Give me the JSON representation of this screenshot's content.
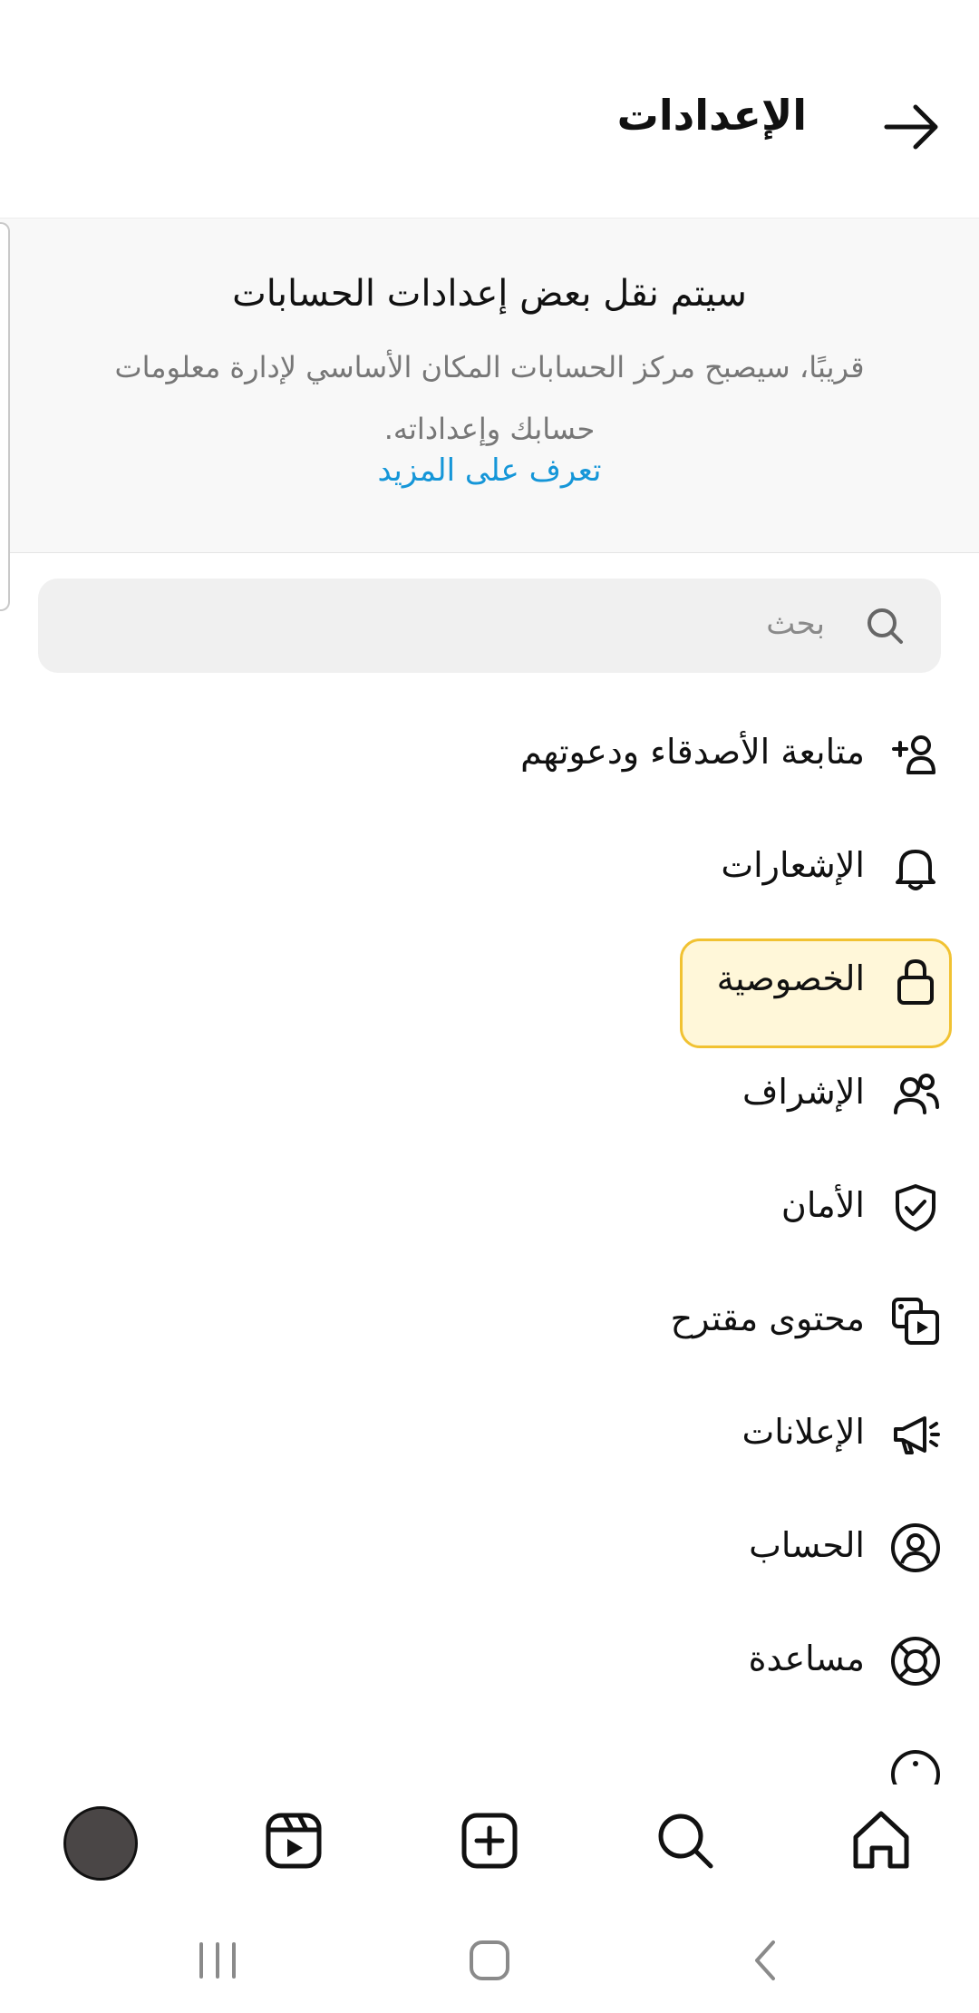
{
  "header": {
    "title": "الإعدادات"
  },
  "banner": {
    "title": "سيتم نقل بعض إعدادات الحسابات",
    "body": "قريبًا، سيصبح مركز الحسابات المكان الأساسي لإدارة معلومات حسابك وإعداداته.",
    "link": "تعرف على المزيد"
  },
  "search": {
    "placeholder": "بحث"
  },
  "menu": [
    {
      "label": "متابعة الأصدقاء ودعوتهم",
      "icon": "add-person-icon"
    },
    {
      "label": "الإشعارات",
      "icon": "bell-icon"
    },
    {
      "label": "الخصوصية",
      "icon": "lock-icon"
    },
    {
      "label": "الإشراف",
      "icon": "supervision-icon"
    },
    {
      "label": "الأمان",
      "icon": "shield-check-icon"
    },
    {
      "label": "محتوى مقترح",
      "icon": "suggested-content-icon"
    },
    {
      "label": "الإعلانات",
      "icon": "megaphone-icon"
    },
    {
      "label": "الحساب",
      "icon": "account-circle-icon"
    },
    {
      "label": "مساعدة",
      "icon": "lifebuoy-icon"
    }
  ],
  "colors": {
    "link": "#1596d8",
    "highlight_border": "#f1c232",
    "highlight_fill": "#fff7d9"
  }
}
